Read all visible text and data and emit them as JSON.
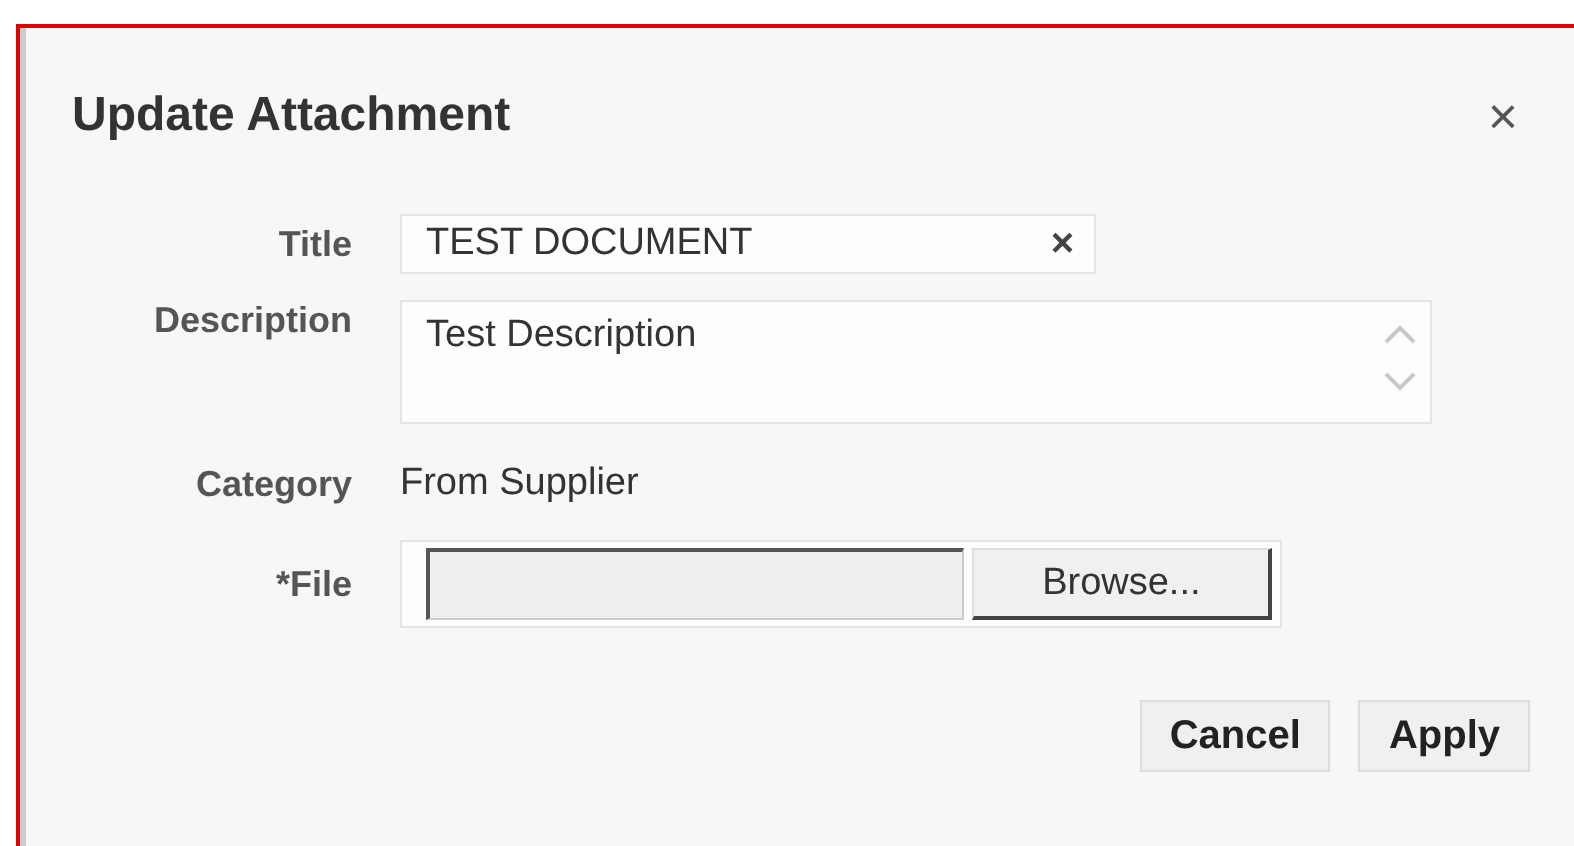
{
  "dialog": {
    "title": "Update Attachment",
    "close": "×"
  },
  "fields": [
    {
      "kind": "text",
      "label": "Title",
      "value": "TEST DOCUMENT",
      "clear": "×"
    },
    {
      "kind": "textarea",
      "label": "Description",
      "value": "Test Description"
    },
    {
      "kind": "static",
      "label": "Category",
      "value": "From Supplier"
    },
    {
      "kind": "file",
      "label": "*File",
      "button": "Browse..."
    }
  ],
  "buttons": [
    "Cancel",
    "Apply"
  ]
}
